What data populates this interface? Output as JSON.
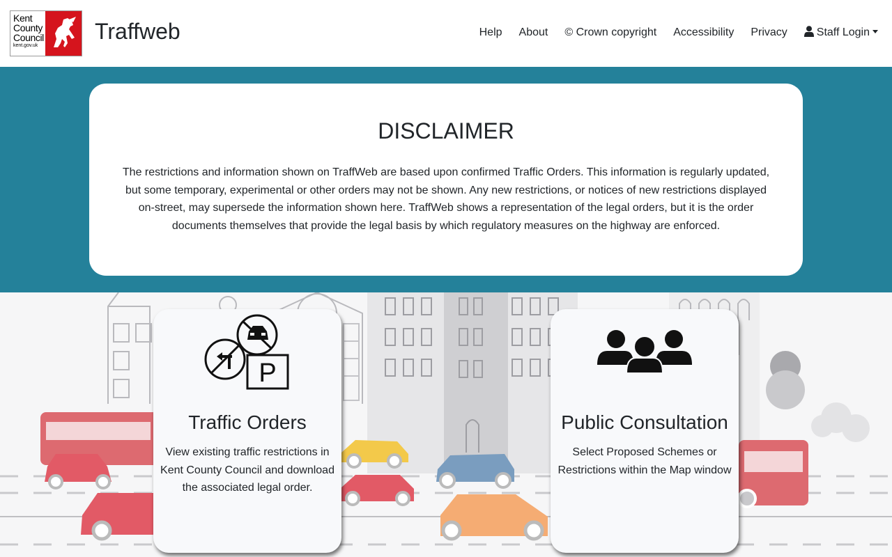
{
  "header": {
    "logo_text": [
      "Kent",
      "County",
      "Council",
      "kent.gov.uk"
    ],
    "brand": "Traffweb",
    "nav": [
      {
        "label": "Help"
      },
      {
        "label": "About"
      },
      {
        "label": "© Crown copyright"
      },
      {
        "label": "Accessibility"
      },
      {
        "label": "Privacy"
      }
    ],
    "staff_login": "Staff Login"
  },
  "disclaimer": {
    "title": "DISCLAIMER",
    "text": "The restrictions and information shown on TraffWeb are based upon confirmed Traffic Orders. This information is regularly updated, but some temporary, experimental or other orders may not be shown. Any new restrictions, or notices of new restrictions displayed on-street, may supersede the information shown here. TraffWeb shows a representation of the legal orders, but it is the order documents themselves that provide the legal basis by which regulatory measures on the highway are enforced."
  },
  "cards": [
    {
      "title": "Traffic Orders",
      "text": "View existing traffic restrictions in Kent County Council and download the associated legal order.",
      "icon": "traffic-orders-icon"
    },
    {
      "title": "Public Consultation",
      "text": "Select Proposed Schemes or Restrictions within the Map window",
      "icon": "users-icon"
    }
  ],
  "colors": {
    "band": "#24819a",
    "kent_red": "#d5141d"
  }
}
